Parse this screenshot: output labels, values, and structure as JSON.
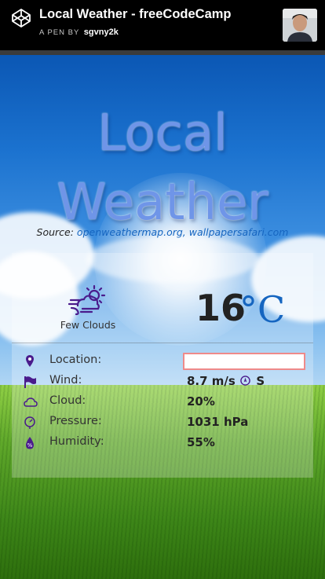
{
  "header": {
    "title": "Local Weather - freeCodeCamp",
    "byline_prefix": "A PEN BY",
    "author": "sgvny2k",
    "logo_icon": "codepen-icon",
    "avatar_icon": "user-avatar"
  },
  "page": {
    "heading_line1": "Local",
    "heading_line2": "Weather",
    "source_prefix": "Source:",
    "source_links": "openweathermap.org, wallpapersafari.com"
  },
  "weather": {
    "condition_icon": "cloud-sun-wind-icon",
    "condition": "Few Clouds",
    "temperature": "16",
    "unit": "°C",
    "accent_color": "#1565c0",
    "icon_color": "#4a1b8c"
  },
  "details": {
    "location_label": "Location:",
    "location_value": "",
    "wind_label": "Wind:",
    "wind_value": "8.7 m/s",
    "wind_direction": "S",
    "cloud_label": "Cloud:",
    "cloud_value": "20%",
    "pressure_label": "Pressure:",
    "pressure_value": "1031 hPa",
    "humidity_label": "Humidity:",
    "humidity_value": "55%"
  }
}
